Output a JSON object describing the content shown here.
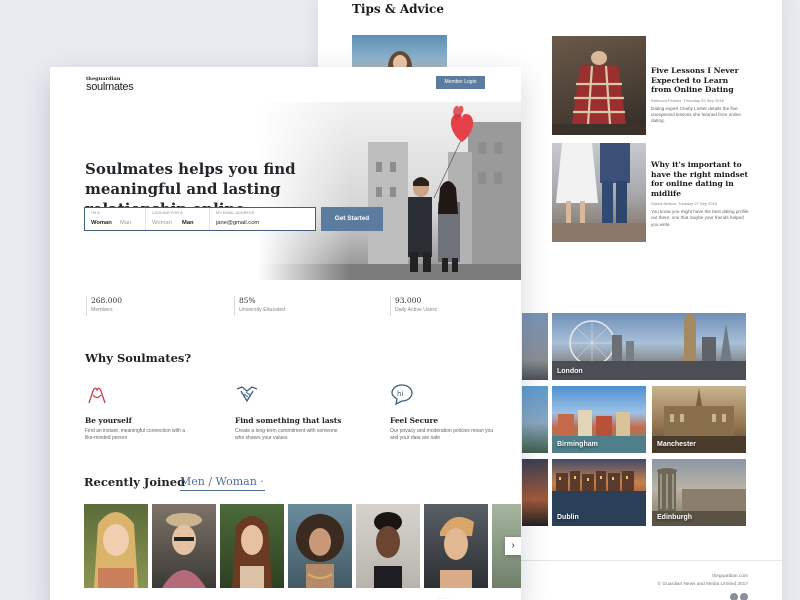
{
  "tips": {
    "title": "Tips & Advice",
    "articles": [
      {
        "title": "Five Lessons I Never Expected to Learn from Online Dating",
        "meta": "Rebecca Perkins, Thursday 29 Sep 2016",
        "desc": "Dating expert Charly Lester details the five unexpected lessons she learned from online dating."
      },
      {
        "title": "Why it's important to have the right mindset for online dating in midlife",
        "meta": "Sasha Nelson, Tuesday 27 Sep 2016",
        "desc": "You know you might have the best dating profile out there, one that maybe your friends helped you write."
      }
    ]
  },
  "cities": [
    "London",
    "Birmingham",
    "Manchester",
    "Dublin",
    "Edinburgh"
  ],
  "footer": {
    "site": "theguardian.com",
    "copyright": "© Guardian News and Media Limited 2017"
  },
  "brand": {
    "small": "theguardian",
    "big": "soulmates"
  },
  "header": {
    "login_label": "Member Login"
  },
  "hero": {
    "title": "Soulmates helps you find meaningful and lasting relationship online",
    "form": {
      "i_am_label": "I'M A",
      "looking_label": "LOOKING FOR A",
      "email_label": "MY EMAIL ADDRESS",
      "opt_woman": "Woman",
      "opt_man": "Man",
      "email_value": "jane@gmail.com"
    },
    "cta": "Get Started"
  },
  "stats": [
    {
      "value": "268.000",
      "label": "Members"
    },
    {
      "value": "85%",
      "label": "University Educated"
    },
    {
      "value": "93.000",
      "label": "Daily Active Users"
    }
  ],
  "why": {
    "title": "Why Soulmates?",
    "features": [
      {
        "title": "Be yourself",
        "desc": "Find an instant, meaningful connection with a like-minded person",
        "icon": "heart-hands-icon"
      },
      {
        "title": "Find something that lasts",
        "desc": "Create a long-term commitment with someone who shares your values",
        "icon": "handshake-icon"
      },
      {
        "title": "Feel Secure",
        "desc": "Our privacy and moderation policies mean you and your data are safe",
        "icon": "speech-bubble-icon"
      }
    ]
  },
  "recent": {
    "title": "Recently Joined",
    "filter": "Men / Woman ·"
  },
  "colors": {
    "accent": "#5b7b9f",
    "page_bg": "#e9ebf1"
  }
}
